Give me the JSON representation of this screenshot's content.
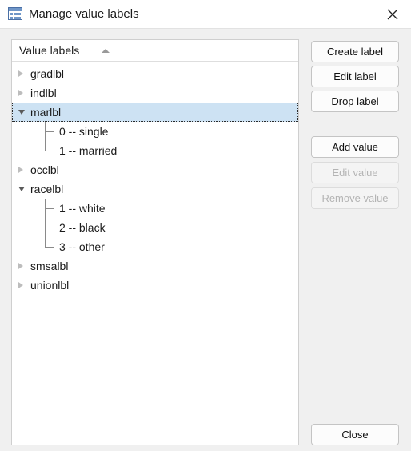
{
  "window": {
    "title": "Manage value labels",
    "icon": "value-labels-icon",
    "close_icon": "close-icon"
  },
  "list": {
    "header": "Value labels",
    "sort_direction": "ascending",
    "sort_icon": "sort-ascending-icon",
    "nodes": [
      {
        "label": "gradlbl",
        "expanded": false,
        "children": []
      },
      {
        "label": "indlbl",
        "expanded": false,
        "children": []
      },
      {
        "label": "marlbl",
        "expanded": true,
        "selected": true,
        "children": [
          "0 -- single",
          "1 -- married"
        ]
      },
      {
        "label": "occlbl",
        "expanded": false,
        "children": []
      },
      {
        "label": "racelbl",
        "expanded": true,
        "children": [
          "1 -- white",
          "2 -- black",
          "3 -- other"
        ]
      },
      {
        "label": "smsalbl",
        "expanded": false,
        "children": []
      },
      {
        "label": "unionlbl",
        "expanded": false,
        "children": []
      }
    ]
  },
  "buttons": {
    "create_label": {
      "label": "Create label",
      "enabled": true
    },
    "edit_label": {
      "label": "Edit label",
      "enabled": true
    },
    "drop_label": {
      "label": "Drop label",
      "enabled": true
    },
    "add_value": {
      "label": "Add value",
      "enabled": true
    },
    "edit_value": {
      "label": "Edit value",
      "enabled": false
    },
    "remove_value": {
      "label": "Remove value",
      "enabled": false
    },
    "close": {
      "label": "Close",
      "enabled": true
    }
  },
  "colors": {
    "dialog_background": "#f0f0f0",
    "titlebar_background": "#ffffff",
    "list_background": "#ffffff",
    "selection": "#cde2f3",
    "button_face": "#fcfcfc",
    "disabled_text": "#b4b4b4",
    "text": "#1b1b1b"
  }
}
